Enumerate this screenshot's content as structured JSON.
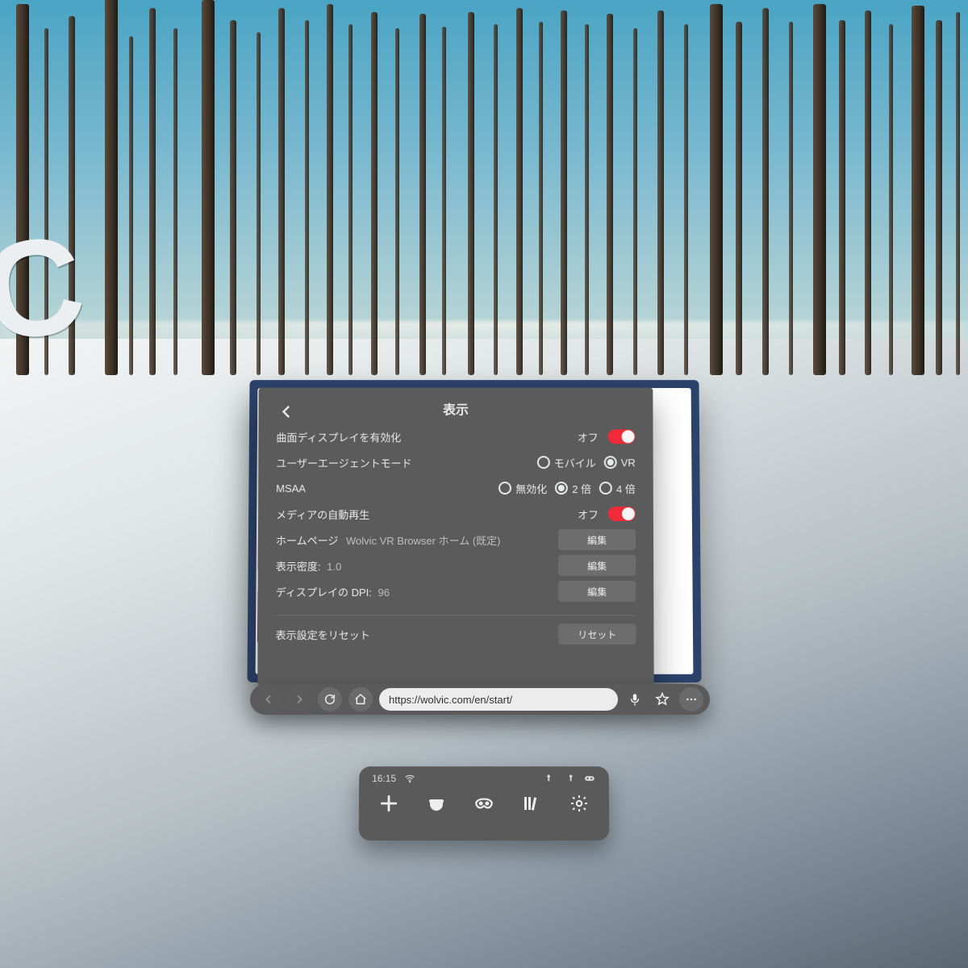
{
  "scene": {
    "c_glyph": "C"
  },
  "settings": {
    "title": "表示",
    "rows": {
      "curved": {
        "label": "曲面ディスプレイを有効化",
        "toggle_text": "オフ"
      },
      "ua": {
        "label": "ユーザーエージェントモード",
        "options": {
          "mobile": "モバイル",
          "vr": "VR"
        },
        "selected": "vr"
      },
      "msaa": {
        "label": "MSAA",
        "options": {
          "off": "無効化",
          "x2": "2 倍",
          "x4": "4 倍"
        },
        "selected": "x2"
      },
      "autoplay": {
        "label": "メディアの自動再生",
        "toggle_text": "オフ"
      },
      "homepage": {
        "label": "ホームページ",
        "value": "Wolvic VR Browser ホーム (既定)",
        "button": "編集"
      },
      "density": {
        "label": "表示密度:",
        "value": "1.0",
        "button": "編集"
      },
      "dpi": {
        "label": "ディスプレイの DPI:",
        "value": "96",
        "button": "編集"
      },
      "reset": {
        "label": "表示設定をリセット",
        "button": "リセット"
      }
    }
  },
  "navbar": {
    "url": "https://wolvic.com/en/start/"
  },
  "tray": {
    "time": "16:15"
  }
}
